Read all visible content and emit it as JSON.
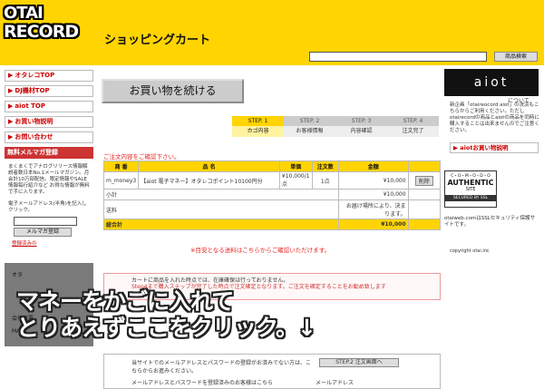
{
  "header": {
    "logo_line1": "OTAI",
    "logo_line2": "RECORD",
    "title": "ショッピングカート",
    "search_button": "商品検索"
  },
  "sidebar": {
    "items": [
      {
        "label": "オタレコTOP"
      },
      {
        "label": "DJ機材TOP"
      },
      {
        "label": "aiot TOP"
      },
      {
        "label": "お買い物説明"
      },
      {
        "label": "お問い合わせ"
      }
    ],
    "mailmag": {
      "heading": "無料メルマガ登録",
      "description": "まくまくでアナログリリース情報解説者数日本No.1メールマガジン。月会計10万部配信。限定情報やSALE情報毎行紹介など お得な情報が無料で手に入ります。",
      "email_prompt": "電子メールアドレス(半角)を記入しクリック。",
      "register_button": "メルマガ登録",
      "unsubscribe_link": "登録済みの"
    },
    "dark_items": [
      "オタ",
      "会社概要",
      "MAP"
    ]
  },
  "main": {
    "continue_button": "お買い物を続ける",
    "steps": [
      {
        "num": "STEP. 1",
        "label": "カゴ内容",
        "active": true
      },
      {
        "num": "STEP. 2",
        "label": "お客様情報",
        "active": false
      },
      {
        "num": "STEP. 3",
        "label": "内容確認",
        "active": false
      },
      {
        "num": "STEP. 4",
        "label": "注文完了",
        "active": false
      }
    ],
    "confirm_text": "ご注文内容をご確認下さい。",
    "table": {
      "headers": [
        "商 番",
        "品 名",
        "単価",
        "注文数",
        "金額",
        ""
      ],
      "item": {
        "code": "m_money3",
        "name": "【aiot 電子マネー】オタレコポイント10100円分",
        "price": "¥10,000/1点",
        "qty": "1点",
        "amount": "¥10,000",
        "delete": "削除"
      },
      "subtotal_label": "小計",
      "subtotal_value": "¥10,000",
      "shipping_label": "送料",
      "shipping_value": "お届け場所により、決まります。",
      "total_label": "総合計",
      "total_value": "¥10,000"
    },
    "shipping_link": "※目安となる送料はこちらからご確認いただけます。",
    "notice_line1": "カートに商品を入れた時点では、在庫確保は行っておりません。",
    "notice_line2": "Step4まで購入ステップが完了した時点で注文確定となります。ご注文を確定することをお勧め致します",
    "step2_text": "当サイトでのメールアドレスとパスワードの登録がお済みでない方は、こちらからお進みください。",
    "step2_button": "STEP.2 注文画面へ",
    "email_login_text": "メールアドレスとパスワードを登録済みのお客様はこちら",
    "email_label": "メールアドレス"
  },
  "overlay": {
    "line1": "マネーをかごに入れて",
    "line2": "とりあえずここをクリック。↓"
  },
  "right_panel": {
    "aiot_logo": "aiot",
    "aiot_about": "について",
    "aiot_description": "新企画「otaireocord aiot」の決済もこちらからご利用ください。ただしotairecordの商品とaiotの商品を同時に購入することは出来ませんのでご注意ください。",
    "aiot_howto": "aiotお買い物説明",
    "ssl_line1": "C・O・M・O・D・O",
    "ssl_line2": "AUTHENTIC",
    "ssl_line3": "SITE",
    "ssl_line4": "SECURED BY SSL",
    "ssl_description": "otaiweb.comはSSLセキュリティ保護サイトです。",
    "copyright": "copyright otai.inc"
  }
}
